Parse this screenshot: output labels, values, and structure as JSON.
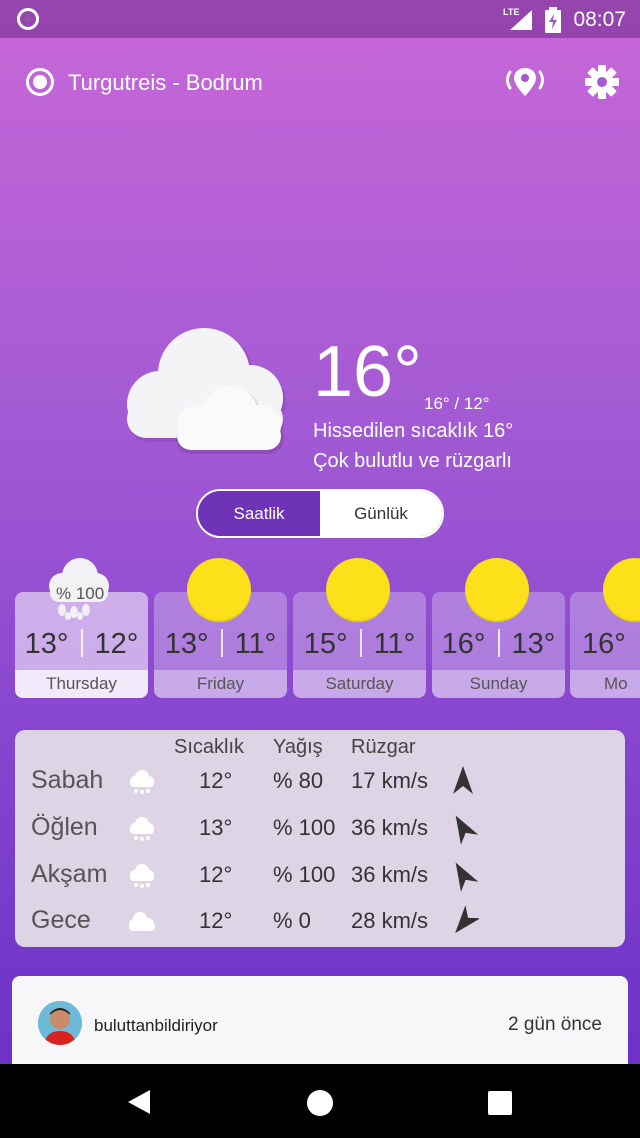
{
  "status_bar": {
    "time": "08:07",
    "network": "LTE"
  },
  "header": {
    "location": "Turgutreis - Bodrum"
  },
  "current": {
    "temp": "16°",
    "high_low": "16° / 12°",
    "feels_like": "Hissedilen sıcaklık 16°",
    "condition": "Çok bulutlu ve rüzgarlı",
    "icon": "cloud-icon"
  },
  "view_toggle": {
    "hourly": "Saatlik",
    "daily": "Günlük",
    "selected": "Saatlik"
  },
  "days": [
    {
      "name": "Thursday",
      "high": "13°",
      "low": "12°",
      "icon": "rain-cloud-icon",
      "precip": "% 100"
    },
    {
      "name": "Friday",
      "high": "13°",
      "low": "11°",
      "icon": "sun-icon"
    },
    {
      "name": "Saturday",
      "high": "15°",
      "low": "11°",
      "icon": "sun-icon"
    },
    {
      "name": "Sunday",
      "high": "16°",
      "low": "13°",
      "icon": "sun-icon"
    },
    {
      "name": "Mo",
      "high": "16°",
      "low": "",
      "icon": "sun-icon"
    }
  ],
  "detail": {
    "headers": {
      "temp": "Sıcaklık",
      "rain": "Yağış",
      "wind": "Rüzgar"
    },
    "rows": [
      {
        "period": "Sabah",
        "temp": "12°",
        "rain": "% 80",
        "wind": "17 km/s",
        "icon": "rain-cloud-icon"
      },
      {
        "period": "Öğlen",
        "temp": "13°",
        "rain": "% 100",
        "wind": "36 km/s",
        "icon": "rain-cloud-icon"
      },
      {
        "period": "Akşam",
        "temp": "12°",
        "rain": "% 100",
        "wind": "36 km/s",
        "icon": "rain-cloud-icon"
      },
      {
        "period": "Gece",
        "temp": "12°",
        "rain": "% 0",
        "wind": "28 km/s",
        "icon": "cloud-icon"
      }
    ]
  },
  "post": {
    "user": "buluttanbildiriyor",
    "time": "2 gün önce"
  },
  "colors": {
    "accent": "#6f33b8",
    "sun": "#fbe01a"
  }
}
